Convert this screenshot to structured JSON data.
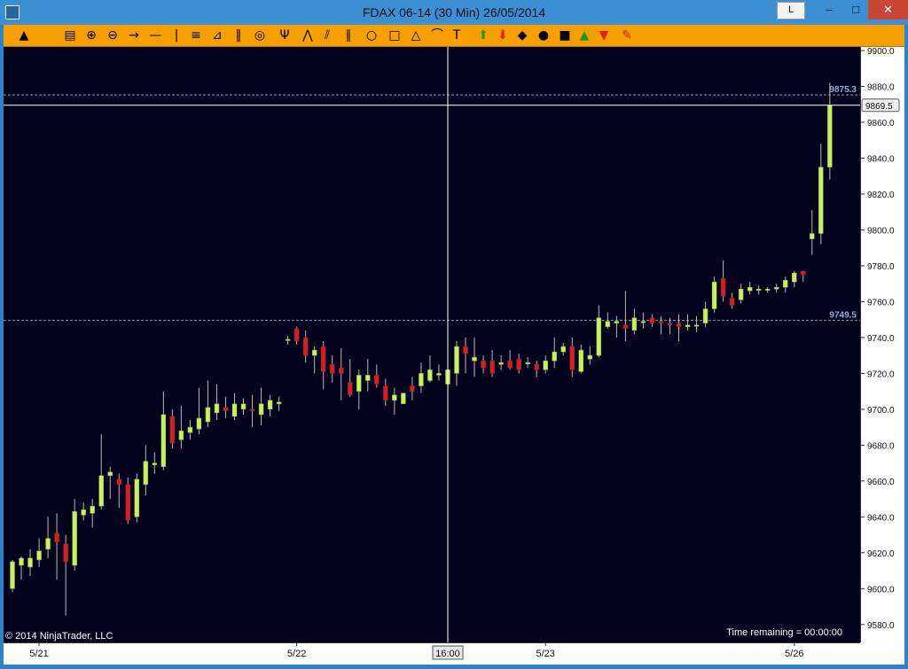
{
  "window": {
    "title": "FDAX 06-14 (30 Min)  26/05/2014",
    "btn_l": "L",
    "minimize": "–",
    "maximize": "□",
    "close": "✕"
  },
  "toolbar": {
    "icons": [
      "cursor-icon",
      "data-box-icon",
      "zoom-in-icon",
      "zoom-out-icon",
      "arrow-line-icon",
      "horizontal-line-icon",
      "vertical-line-icon",
      "fib-retracement-icon",
      "fib-extension-icon",
      "fib-timezone-icon",
      "fib-circle-icon",
      "andrews-pitchfork-icon",
      "gann-fan-icon",
      "regression-channel-icon",
      "trend-channel-icon",
      "ellipse-icon",
      "rectangle-icon",
      "triangle-icon",
      "arc-icon",
      "text-icon",
      "arrow-up-icon",
      "arrow-down-icon",
      "diamond-icon",
      "dot-icon",
      "square-icon",
      "triangle-up-icon",
      "triangle-down-icon",
      "eraser-icon"
    ]
  },
  "colors": {
    "background": "#03031e",
    "up": "#c8f060",
    "down": "#d0202a",
    "wick": "#b8b8b8",
    "crosshair": "#ffffff",
    "dashed": "#8ab0d8"
  },
  "chart_data": {
    "type": "candlestick",
    "ylim": [
      9570,
      9902
    ],
    "y_ticks": [
      9580,
      9600,
      9620,
      9640,
      9660,
      9680,
      9700,
      9720,
      9740,
      9760,
      9780,
      9800,
      9820,
      9840,
      9860,
      9880,
      9900
    ],
    "x_tick_labels": [
      "5/21",
      "5/22",
      "5/23",
      "5/26"
    ],
    "x_tick_index": [
      3,
      32,
      60,
      88
    ],
    "crosshair": {
      "price_label": "9869.5",
      "time_label": "16:00",
      "price": 9869.5,
      "index": 49
    },
    "hlines": [
      {
        "label": "9875.3",
        "value": 9875.3
      },
      {
        "label": "9749.5",
        "value": 9749.5
      }
    ],
    "copyright": "© 2014 NinjaTrader, LLC",
    "time_remaining": "Time remaining = 00:00:00",
    "candles": [
      [
        9600,
        9615,
        9598,
        9616
      ],
      [
        9613,
        9617,
        9605,
        9618
      ],
      [
        9612,
        9617,
        9607,
        9622
      ],
      [
        9616,
        9621,
        9612,
        9628
      ],
      [
        9622,
        9628,
        9617,
        9640
      ],
      [
        9631,
        9626,
        9605,
        9642
      ],
      [
        9625,
        9615,
        9585,
        9630
      ],
      [
        9613,
        9643,
        9610,
        9650
      ],
      [
        9641,
        9644,
        9638,
        9648
      ],
      [
        9642,
        9646,
        9634,
        9650
      ],
      [
        9646,
        9663,
        9644,
        9686
      ],
      [
        9663,
        9665,
        9650,
        9668
      ],
      [
        9661,
        9658,
        9645,
        9664
      ],
      [
        9658,
        9638,
        9636,
        9662
      ],
      [
        9640,
        9661,
        9637,
        9664
      ],
      [
        9658,
        9671,
        9652,
        9680
      ],
      [
        9669,
        9670,
        9664,
        9676
      ],
      [
        9668,
        9697,
        9666,
        9710
      ],
      [
        9696,
        9681,
        9678,
        9700
      ],
      [
        9683,
        9688,
        9678,
        9702
      ],
      [
        9687,
        9690,
        9683,
        9694
      ],
      [
        9689,
        9695,
        9686,
        9712
      ],
      [
        9693,
        9701,
        9690,
        9716
      ],
      [
        9698,
        9703,
        9694,
        9714
      ],
      [
        9701,
        9699,
        9695,
        9707
      ],
      [
        9696,
        9703,
        9694,
        9709
      ],
      [
        9700,
        9703,
        9697,
        9706
      ],
      [
        9700,
        9699,
        9690,
        9708
      ],
      [
        9697,
        9703,
        9691,
        9712
      ],
      [
        9700,
        9705,
        9696,
        9708
      ],
      [
        9703,
        9704,
        9699,
        9707
      ],
      [
        9739,
        9739,
        9741,
        9736
      ],
      [
        9745,
        9738,
        9736,
        9746
      ],
      [
        9740,
        9730,
        9726,
        9744
      ],
      [
        9730,
        9733,
        9720,
        9735
      ],
      [
        9735,
        9721,
        9711,
        9738
      ],
      [
        9725,
        9720,
        9715,
        9730
      ],
      [
        9723,
        9720,
        9705,
        9734
      ],
      [
        9715,
        9708,
        9707,
        9728
      ],
      [
        9710,
        9719,
        9700,
        9722
      ],
      [
        9716,
        9719,
        9710,
        9728
      ],
      [
        9719,
        9714,
        9712,
        9725
      ],
      [
        9713,
        9705,
        9702,
        9717
      ],
      [
        9705,
        9708,
        9697,
        9712
      ],
      [
        9703,
        9709,
        9705,
        9709
      ],
      [
        9713,
        9710,
        9705,
        9718
      ],
      [
        9713,
        9720,
        9709,
        9726
      ],
      [
        9716,
        9722,
        9715,
        9730
      ],
      [
        9719,
        9720,
        9716,
        9725
      ],
      [
        9714,
        9722,
        9710,
        9729
      ],
      [
        9720,
        9735,
        9713,
        9738
      ],
      [
        9735,
        9731,
        9720,
        9740
      ],
      [
        9727,
        9729,
        9718,
        9740
      ],
      [
        9727,
        9723,
        9720,
        9730
      ],
      [
        9727,
        9720,
        9718,
        9733
      ],
      [
        9725,
        9726,
        9722,
        9730
      ],
      [
        9727,
        9723,
        9722,
        9733
      ],
      [
        9728,
        9722,
        9720,
        9731
      ],
      [
        9726,
        9726,
        9723,
        9729
      ],
      [
        9725,
        9722,
        9718,
        9727
      ],
      [
        9722,
        9727,
        9720,
        9730
      ],
      [
        9727,
        9732,
        9723,
        9740
      ],
      [
        9732,
        9735,
        9730,
        9737
      ],
      [
        9735,
        9722,
        9718,
        9740
      ],
      [
        9721,
        9733,
        9720,
        9736
      ],
      [
        9728,
        9730,
        9725,
        9735
      ],
      [
        9730,
        9751,
        9729,
        9758
      ],
      [
        9746,
        9749,
        9745,
        9754
      ],
      [
        9748,
        9749,
        9740,
        9752
      ],
      [
        9747,
        9745,
        9738,
        9766
      ],
      [
        9744,
        9751,
        9742,
        9756
      ],
      [
        9749,
        9749,
        9745,
        9754
      ],
      [
        9751,
        9748,
        9746,
        9753
      ],
      [
        9749,
        9748,
        9742,
        9752
      ],
      [
        9748,
        9747,
        9742,
        9751
      ],
      [
        9748,
        9746,
        9738,
        9753
      ],
      [
        9746,
        9747,
        9744,
        9753
      ],
      [
        9747,
        9747,
        9743,
        9752
      ],
      [
        9748,
        9756,
        9746,
        9760
      ],
      [
        9756,
        9771,
        9754,
        9774
      ],
      [
        9773,
        9763,
        9760,
        9783
      ],
      [
        9762,
        9758,
        9756,
        9765
      ],
      [
        9761,
        9767,
        9759,
        9770
      ],
      [
        9766,
        9768,
        9764,
        9771
      ],
      [
        9767,
        9767,
        9764,
        9769
      ],
      [
        9767,
        9767,
        9765,
        9768
      ],
      [
        9767,
        9768,
        9765,
        9770
      ],
      [
        9768,
        9772,
        9765,
        9774
      ],
      [
        9771,
        9776,
        9768,
        9777
      ],
      [
        9777,
        9775,
        9771,
        9777
      ],
      [
        9795,
        9798,
        9786,
        9811
      ],
      [
        9798,
        9835,
        9792,
        9848
      ],
      [
        9835,
        9869.5,
        9828,
        9882
      ]
    ]
  }
}
